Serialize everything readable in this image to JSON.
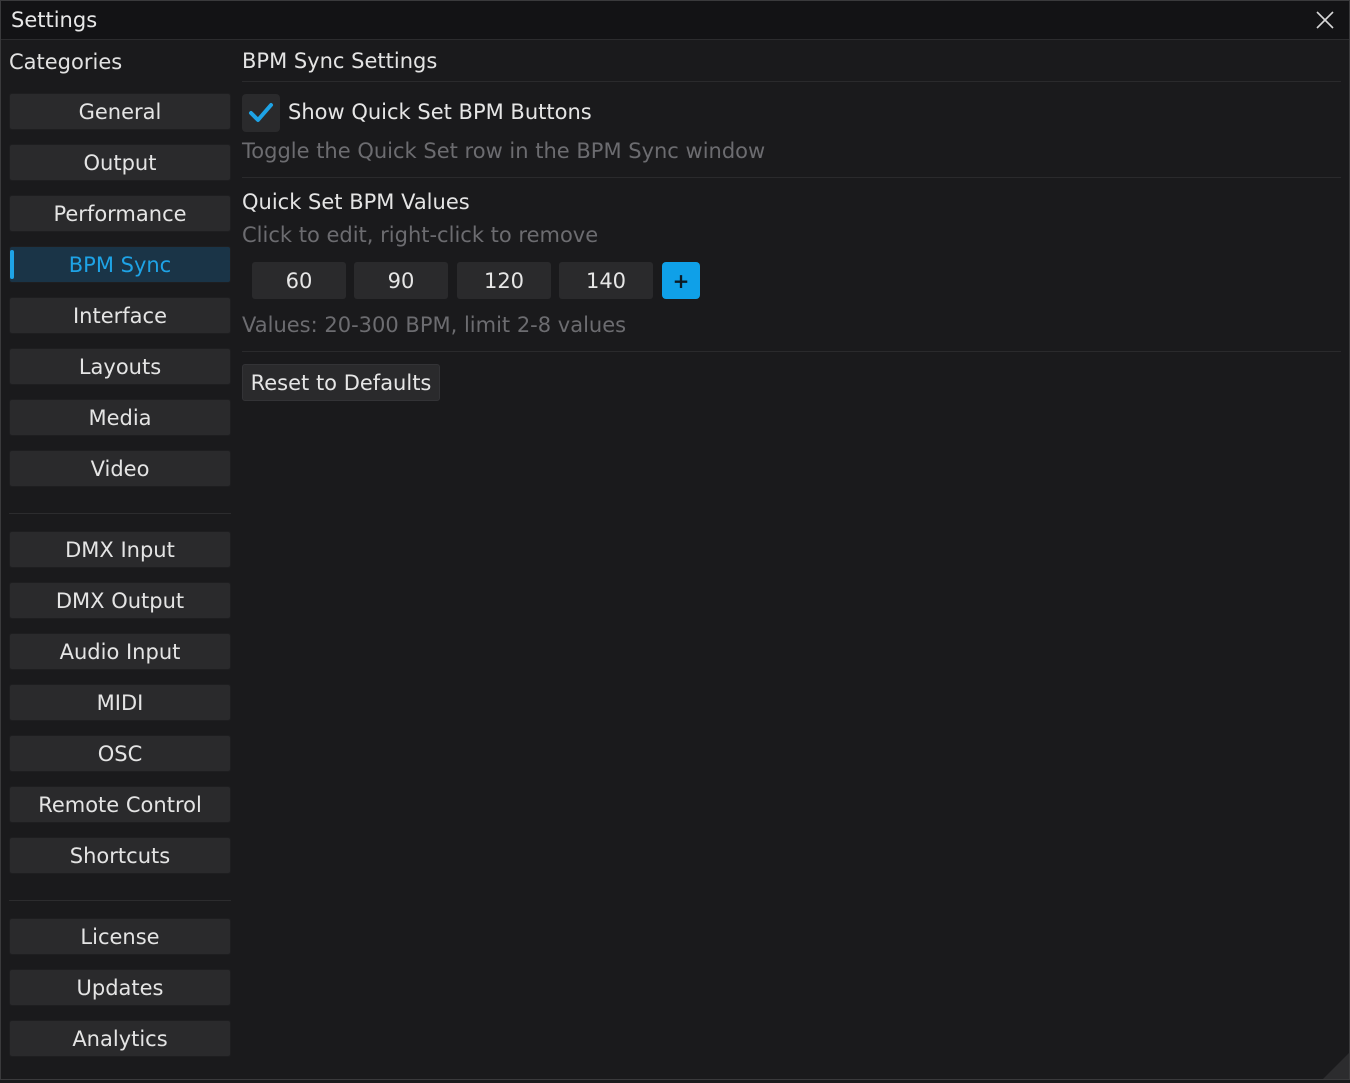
{
  "window": {
    "title": "Settings",
    "close_icon": "close-icon"
  },
  "sidebar": {
    "heading": "Categories",
    "groups": [
      [
        "General",
        "Output",
        "Performance",
        "BPM Sync",
        "Interface",
        "Layouts",
        "Media",
        "Video"
      ],
      [
        "DMX Input",
        "DMX Output",
        "Audio Input",
        "MIDI",
        "OSC",
        "Remote Control",
        "Shortcuts"
      ],
      [
        "License",
        "Updates",
        "Analytics"
      ]
    ],
    "active": "BPM Sync"
  },
  "main": {
    "title": "BPM Sync Settings",
    "show_quick_set": {
      "label": "Show Quick Set BPM Buttons",
      "checked": true,
      "hint": "Toggle the Quick Set row in the BPM Sync window"
    },
    "quick_set": {
      "title": "Quick Set BPM Values",
      "hint": "Click to edit, right-click to remove",
      "values": [
        "60",
        "90",
        "120",
        "140"
      ],
      "add_label": "+",
      "limits": "Values: 20-300 BPM, limit 2-8 values"
    },
    "reset_label": "Reset to Defaults"
  },
  "colors": {
    "accent": "#1ea3e6",
    "background": "#1a1a1c",
    "button": "#2a2a2c"
  }
}
